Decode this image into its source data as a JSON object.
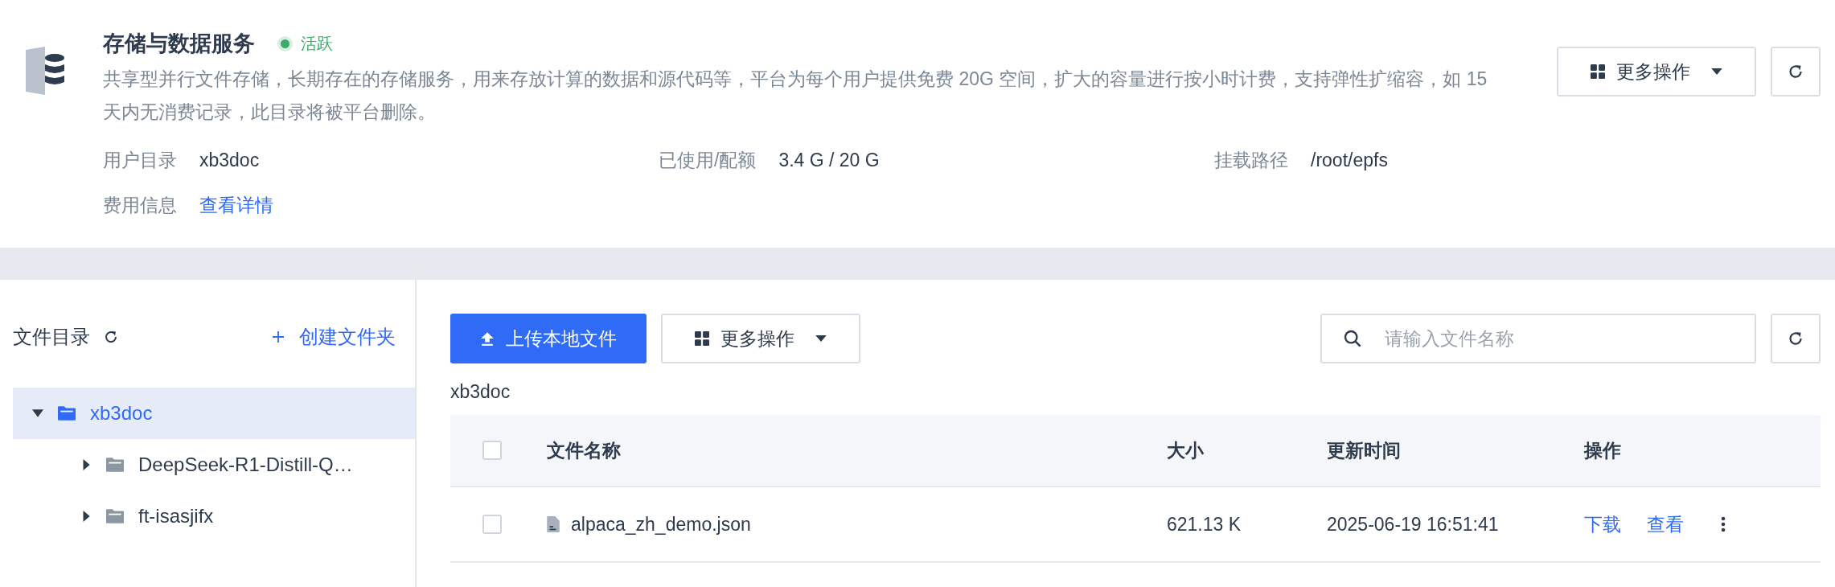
{
  "service": {
    "title": "存储与数据服务",
    "status": "活跃",
    "description": "共享型并行文件存储，长期存在的存储服务，用来存放计算的数据和源代码等，平台为每个用户提供免费 20G 空间，扩大的容量进行按小时计费，支持弹性扩缩容，如 15 天内无消费记录，此目录将被平台删除。",
    "info": [
      {
        "label": "用户目录",
        "value": "xb3doc",
        "kind": "text"
      },
      {
        "label": "已使用/配额",
        "value": "3.4 G / 20 G",
        "kind": "text"
      },
      {
        "label": "挂载路径",
        "value": "/root/epfs",
        "kind": "text"
      },
      {
        "label": "费用信息",
        "value": "查看详情",
        "kind": "link"
      }
    ],
    "more_button": "更多操作"
  },
  "sidebar": {
    "title": "文件目录",
    "create_button": "创建文件夹",
    "tree": [
      {
        "label": "xb3doc",
        "selected": true,
        "expanded": true,
        "children": [
          {
            "label": "DeepSeek-R1-Distill-Q…",
            "selected": false,
            "expanded": false
          },
          {
            "label": "ft-isasjifx",
            "selected": false,
            "expanded": false
          }
        ]
      }
    ]
  },
  "toolbar": {
    "upload_button": "上传本地文件",
    "more_button": "更多操作",
    "search": {
      "placeholder": "请输入文件名称"
    }
  },
  "breadcrumb": "xb3doc",
  "table": {
    "header_checked": false,
    "columns": [
      "文件名称",
      "大小",
      "更新时间",
      "操作"
    ],
    "rows": [
      {
        "checked": false,
        "name": "alpaca_zh_demo.json",
        "size": "621.13 K",
        "updated": "2025-06-19 16:51:41",
        "actions": [
          "下载",
          "查看"
        ]
      }
    ]
  }
}
